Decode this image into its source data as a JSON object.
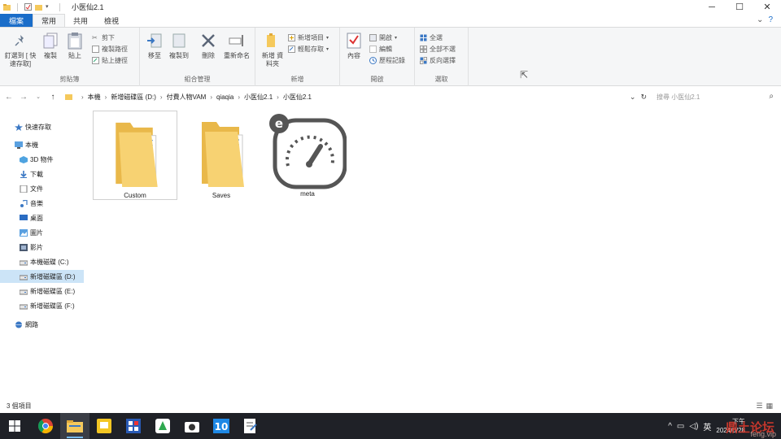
{
  "window": {
    "title": "小医仙2.1",
    "controls": {
      "minimize": "─",
      "maximize": "☐",
      "close": "✕"
    }
  },
  "tabs": [
    {
      "label": "檔案",
      "kind": "file"
    },
    {
      "label": "常用",
      "kind": "active"
    },
    {
      "label": "共用",
      "kind": "normal"
    },
    {
      "label": "檢視",
      "kind": "normal"
    }
  ],
  "ribbon": {
    "clipboard": {
      "label": "剪貼簿",
      "pin": "釘選到 [ 快速存取]",
      "copy": "複製",
      "paste": "貼上",
      "cut": "剪下",
      "copy_path": "複製路徑",
      "paste_shortcut": "貼上捷徑"
    },
    "organize": {
      "label": "組合管理",
      "move_to": "移至",
      "copy_to": "複製到",
      "delete": "刪除",
      "rename": "重新命名"
    },
    "new": {
      "label": "新增",
      "new_folder": "新增 資料夾",
      "new_item": "新增項目",
      "easy_access": "輕鬆存取"
    },
    "open": {
      "label": "開啟",
      "properties": "內容",
      "open": "開啟",
      "edit": "編輯",
      "history": "歷程記錄"
    },
    "select": {
      "label": "選取",
      "select_all": "全選",
      "select_none": "全部不選",
      "invert": "反向選擇"
    }
  },
  "address": {
    "crumbs": [
      "本機",
      "新增磁碟區 (D:)",
      "付費人物VAM",
      "qiaqia",
      "小医仙2.1",
      "小医仙2.1"
    ],
    "search_placeholder": "搜尋 小医仙2.1"
  },
  "nav": {
    "items": [
      {
        "label": "快速存取",
        "icon": "star-icon",
        "indent": 0,
        "selected": false
      },
      {
        "label": "本機",
        "icon": "computer-icon",
        "indent": 0,
        "selected": false
      },
      {
        "label": "3D 物件",
        "icon": "cube-icon",
        "indent": 1,
        "selected": false
      },
      {
        "label": "下載",
        "icon": "download-icon",
        "indent": 1,
        "selected": false
      },
      {
        "label": "文件",
        "icon": "document-icon",
        "indent": 1,
        "selected": false
      },
      {
        "label": "音樂",
        "icon": "music-icon",
        "indent": 1,
        "selected": false
      },
      {
        "label": "桌面",
        "icon": "desktop-icon",
        "indent": 1,
        "selected": false
      },
      {
        "label": "圖片",
        "icon": "pictures-icon",
        "indent": 1,
        "selected": false
      },
      {
        "label": "影片",
        "icon": "video-icon",
        "indent": 1,
        "selected": false
      },
      {
        "label": "本機磁碟 (C:)",
        "icon": "drive-icon",
        "indent": 1,
        "selected": false
      },
      {
        "label": "新增磁碟區 (D:)",
        "icon": "drive-icon",
        "indent": 1,
        "selected": true
      },
      {
        "label": "新增磁碟區 (E:)",
        "icon": "drive-icon",
        "indent": 1,
        "selected": false
      },
      {
        "label": "新增磁碟區 (F:)",
        "icon": "drive-icon",
        "indent": 1,
        "selected": false
      },
      {
        "label": "網路",
        "icon": "network-icon",
        "indent": 0,
        "selected": false
      }
    ]
  },
  "files": [
    {
      "name": "Custom",
      "type": "folder",
      "selected": true
    },
    {
      "name": "Saves",
      "type": "folder",
      "selected": false
    },
    {
      "name": "meta",
      "type": "gauge-file",
      "selected": false
    }
  ],
  "status": {
    "count": "3 個項目"
  },
  "taskbar": {
    "tray_lang": "英",
    "clock_line1": "下午",
    "clock_line2": "2024/0/28",
    "watermark": "鼎土论坛",
    "watermark_sub": "feng.vip"
  },
  "colors": {
    "accent": "#1a6dc9",
    "folder": "#f5c95c",
    "selected_nav": "#cce4f7",
    "taskbar": "#1f2127"
  }
}
